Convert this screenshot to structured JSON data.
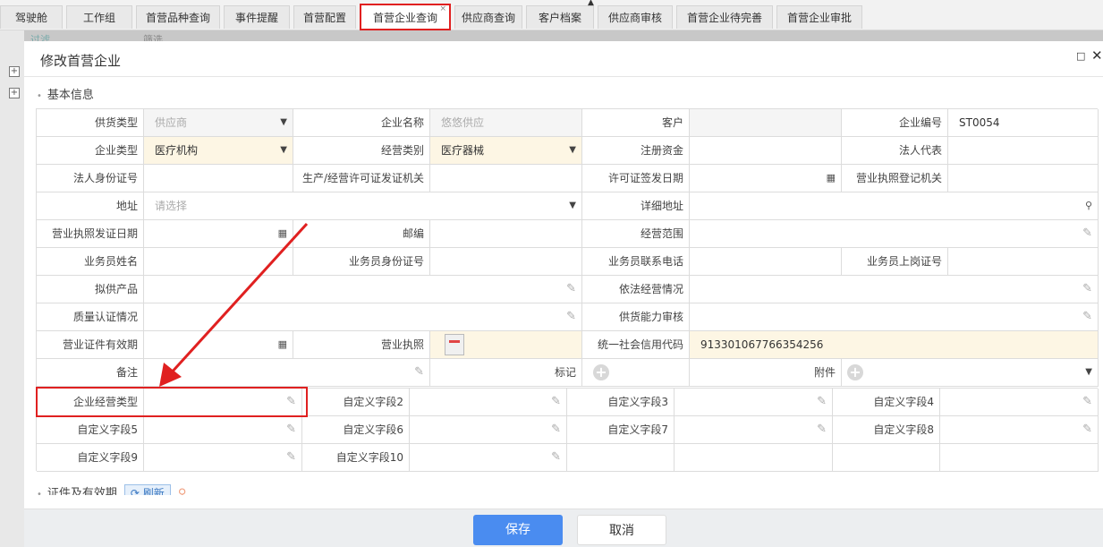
{
  "tabs": [
    "驾驶舱",
    "工作组",
    "首营品种查询",
    "事件提醒",
    "首营配置",
    "首营企业查询",
    "供应商查询",
    "客户档案",
    "供应商审核",
    "首营企业待完善",
    "首营企业审批"
  ],
  "active_tab_close": "×",
  "behind": {
    "partial_left": "过滤",
    "partial_mid": "筛选"
  },
  "modal": {
    "title": "修改首营企业",
    "section_basic": "基本信息",
    "section_cert": "证件及有效期",
    "refresh_label": "刷新",
    "save_label": "保存",
    "cancel_label": "取消"
  },
  "form": {
    "supply_type_label": "供货类型",
    "supply_type_value": "供应商",
    "company_name_label": "企业名称",
    "company_name_value": "悠悠供应",
    "customer_label": "客户",
    "customer_value": "",
    "company_no_label": "企业编号",
    "company_no_value": "ST0054",
    "company_type_label": "企业类型",
    "company_type_value": "医疗机构",
    "biz_category_label": "经营类别",
    "biz_category_value": "医疗器械",
    "reg_capital_label": "注册资金",
    "legal_rep_label": "法人代表",
    "legal_id_label": "法人身份证号",
    "license_authority_label": "生产/经营许可证发证机关",
    "license_issue_date_label": "许可证签发日期",
    "biz_license_authority_label": "营业执照登记机关",
    "address_label": "地址",
    "address_placeholder": "请选择",
    "detail_address_label": "详细地址",
    "biz_license_date_label": "营业执照发证日期",
    "postcode_label": "邮编",
    "biz_scope_label": "经营范围",
    "salesman_name_label": "业务员姓名",
    "salesman_id_label": "业务员身份证号",
    "salesman_phone_label": "业务员联系电话",
    "salesman_cert_label": "业务员上岗证号",
    "planned_product_label": "拟供产品",
    "lawful_biz_label": "依法经营情况",
    "quality_cert_label": "质量认证情况",
    "supply_capacity_label": "供货能力审核",
    "cert_validity_label": "营业证件有效期",
    "biz_license_label": "营业执照",
    "credit_code_label": "统一社会信用代码",
    "credit_code_value": "913301067766354256",
    "remark_label": "备注",
    "mark_label": "标记",
    "attachment_label": "附件",
    "custom1_label": "企业经营类型",
    "custom2_label": "自定义字段2",
    "custom3_label": "自定义字段3",
    "custom4_label": "自定义字段4",
    "custom5_label": "自定义字段5",
    "custom6_label": "自定义字段6",
    "custom7_label": "自定义字段7",
    "custom8_label": "自定义字段8",
    "custom9_label": "自定义字段9",
    "custom10_label": "自定义字段10"
  },
  "colors": {
    "highlight": "#e02020",
    "primary": "#4a8cf0",
    "yellow_field": "#fdf6e4"
  }
}
